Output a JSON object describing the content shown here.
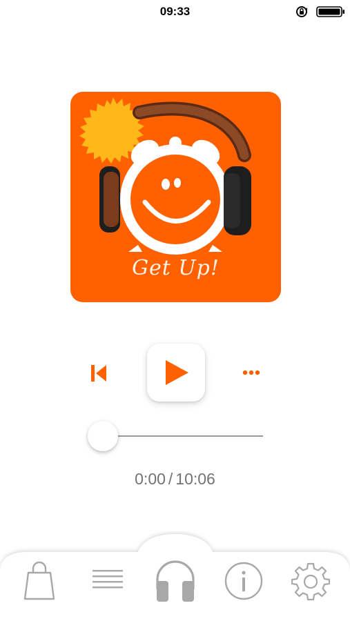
{
  "status_bar": {
    "time": "09:33",
    "icons": [
      "rotation-lock-icon",
      "battery-icon"
    ]
  },
  "album": {
    "title": "Get Up!",
    "background_color": "#ff6000",
    "artwork": [
      "sun",
      "alarm-clock-face",
      "headphones"
    ]
  },
  "player": {
    "controls": [
      "skip-previous-icon",
      "play-icon",
      "more-icon"
    ],
    "accent_color": "#ff6000",
    "progress": 0,
    "current_time": "0:00",
    "separator": "/",
    "total_time": "10:06"
  },
  "bottom_nav": {
    "items": [
      {
        "icon": "shopping-bag-icon",
        "active": false
      },
      {
        "icon": "list-icon",
        "active": false
      },
      {
        "icon": "headphones-icon",
        "active": true
      },
      {
        "icon": "info-icon",
        "active": false
      },
      {
        "icon": "gear-icon",
        "active": false
      }
    ],
    "icon_color": "#a8a8a8"
  }
}
